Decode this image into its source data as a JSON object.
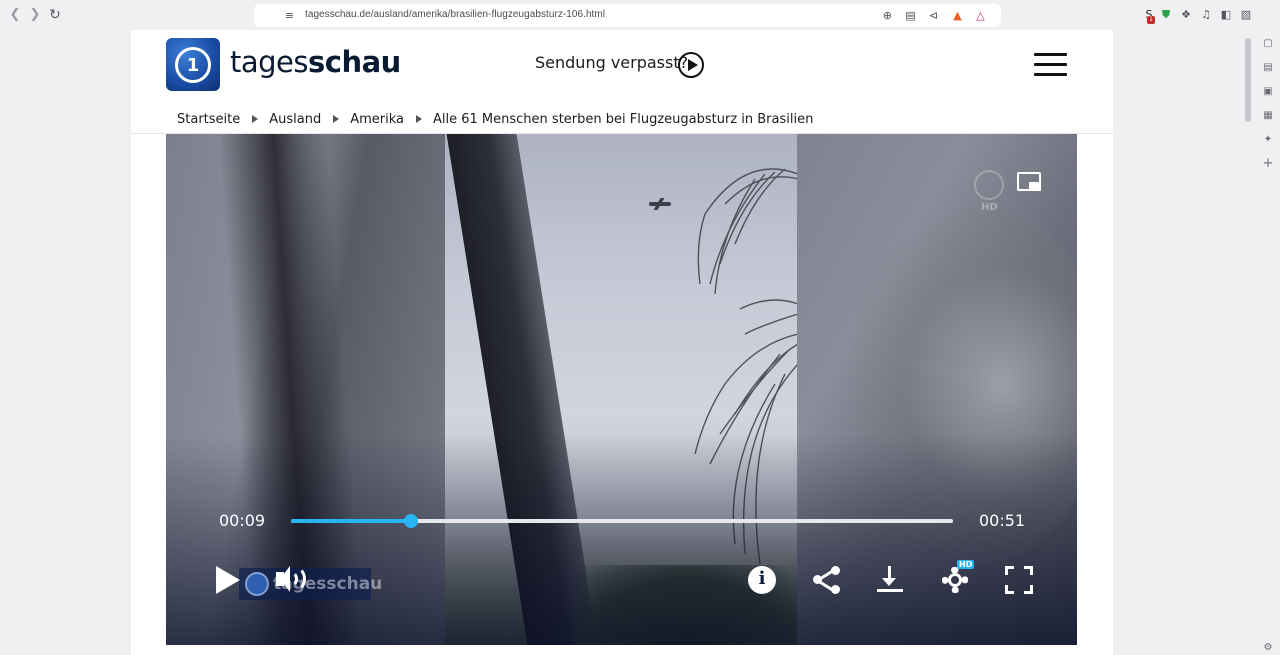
{
  "browser": {
    "url": "tagesschau.de/ausland/amerika/brasilien-flugzeugabsturz-106.html",
    "extension_badge": "1"
  },
  "header": {
    "brand_regular": "tages",
    "brand_bold": "schau",
    "sendung_label": "Sendung verpasst?"
  },
  "breadcrumb": [
    "Startseite",
    "Ausland",
    "Amerika",
    "Alle 61 Menschen sterben bei Flugzeugabsturz in Brasilien"
  ],
  "player": {
    "current_time": "00:09",
    "duration": "00:51",
    "progress_fraction": 0.182,
    "watermark_text": "tagesschau",
    "corner_badge": "HD",
    "settings_badge": "HD",
    "accent_color": "#27b6f2"
  },
  "icons": {
    "back": "chevron-left-icon",
    "forward": "chevron-right-icon",
    "reload": "reload-icon",
    "bookmark": "bookmark-icon",
    "menu": "hamburger-icon",
    "play": "play-icon",
    "volume": "speaker-icon",
    "info": "info-icon",
    "share": "share-icon",
    "download": "download-icon",
    "settings": "gear-icon",
    "fullscreen": "fullscreen-icon",
    "pip": "picture-in-picture-icon"
  }
}
